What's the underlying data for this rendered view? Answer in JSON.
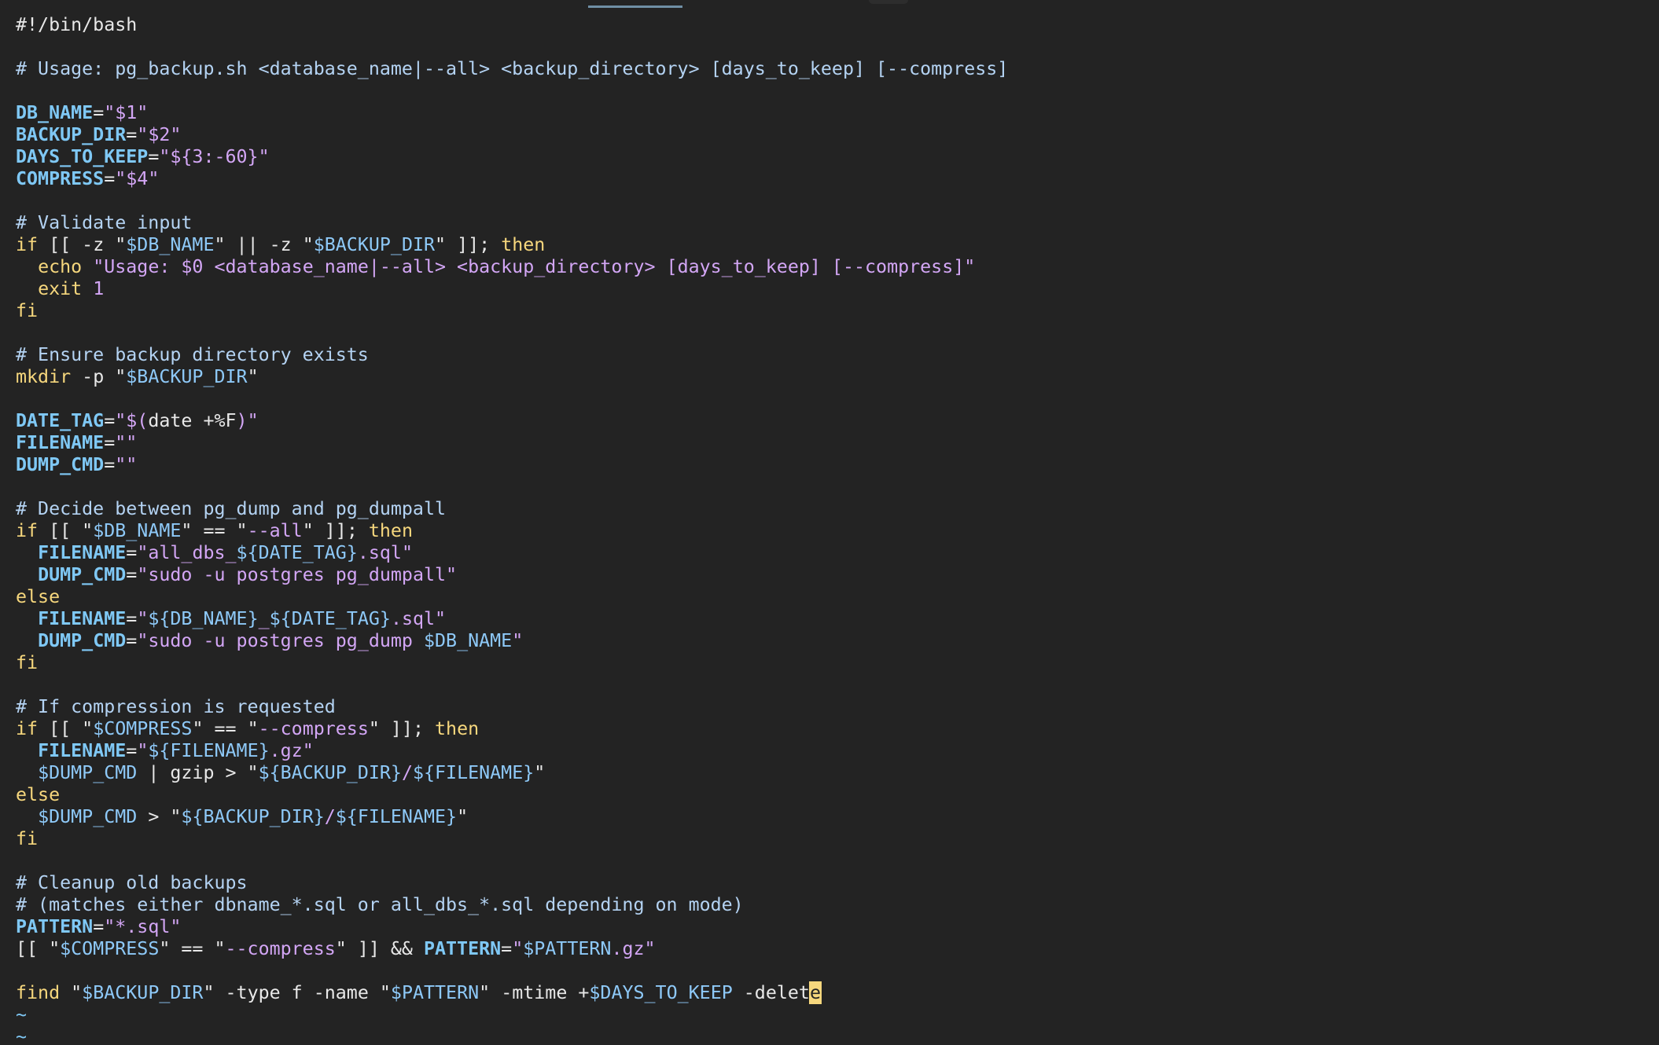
{
  "editor": {
    "lines": [
      [
        {
          "t": "#!/bin/bash",
          "k": "shebang"
        }
      ],
      [],
      [
        {
          "t": "# Usage: pg_backup.sh <database_name|--all> <backup_directory> [days_to_keep] [--compress]",
          "k": "comment"
        }
      ],
      [],
      [
        {
          "t": "DB_NAME",
          "k": "var"
        },
        {
          "t": "=",
          "k": "op"
        },
        {
          "t": "\"$1\"",
          "k": "str"
        }
      ],
      [
        {
          "t": "BACKUP_DIR",
          "k": "var"
        },
        {
          "t": "=",
          "k": "op"
        },
        {
          "t": "\"$2\"",
          "k": "str"
        }
      ],
      [
        {
          "t": "DAYS_TO_KEEP",
          "k": "var"
        },
        {
          "t": "=",
          "k": "op"
        },
        {
          "t": "\"${3:-60}\"",
          "k": "str"
        }
      ],
      [
        {
          "t": "COMPRESS",
          "k": "var"
        },
        {
          "t": "=",
          "k": "op"
        },
        {
          "t": "\"$4\"",
          "k": "str"
        }
      ],
      [],
      [
        {
          "t": "# Validate input",
          "k": "comment"
        }
      ],
      [
        {
          "t": "if",
          "k": "kw"
        },
        {
          "t": " [[ -z \"",
          "k": "plain"
        },
        {
          "t": "$DB_NAME",
          "k": "ref"
        },
        {
          "t": "\" || -z \"",
          "k": "plain"
        },
        {
          "t": "$BACKUP_DIR",
          "k": "ref"
        },
        {
          "t": "\" ]]; ",
          "k": "plain"
        },
        {
          "t": "then",
          "k": "kw"
        }
      ],
      [
        {
          "t": "  ",
          "k": "plain"
        },
        {
          "t": "echo",
          "k": "cmd"
        },
        {
          "t": " \"Usage: $0 <database_name|--all> <backup_directory> [days_to_keep] [--compress]\"",
          "k": "str"
        }
      ],
      [
        {
          "t": "  ",
          "k": "plain"
        },
        {
          "t": "exit",
          "k": "cmd"
        },
        {
          "t": " 1",
          "k": "str"
        }
      ],
      [
        {
          "t": "fi",
          "k": "kw"
        }
      ],
      [],
      [
        {
          "t": "# Ensure backup directory exists",
          "k": "comment"
        }
      ],
      [
        {
          "t": "mkdir",
          "k": "cmd"
        },
        {
          "t": " -p \"",
          "k": "plain"
        },
        {
          "t": "$BACKUP_DIR",
          "k": "ref"
        },
        {
          "t": "\"",
          "k": "plain"
        }
      ],
      [],
      [
        {
          "t": "DATE_TAG",
          "k": "var"
        },
        {
          "t": "=",
          "k": "op"
        },
        {
          "t": "\"$(",
          "k": "str"
        },
        {
          "t": "date +%F",
          "k": "plain"
        },
        {
          "t": ")\"",
          "k": "str"
        }
      ],
      [
        {
          "t": "FILENAME",
          "k": "var"
        },
        {
          "t": "=",
          "k": "op"
        },
        {
          "t": "\"\"",
          "k": "str"
        }
      ],
      [
        {
          "t": "DUMP_CMD",
          "k": "var"
        },
        {
          "t": "=",
          "k": "op"
        },
        {
          "t": "\"\"",
          "k": "str"
        }
      ],
      [],
      [
        {
          "t": "# Decide between pg_dump and pg_dumpall",
          "k": "comment"
        }
      ],
      [
        {
          "t": "if",
          "k": "kw"
        },
        {
          "t": " [[ \"",
          "k": "plain"
        },
        {
          "t": "$DB_NAME",
          "k": "ref"
        },
        {
          "t": "\" == \"",
          "k": "plain"
        },
        {
          "t": "--all",
          "k": "str"
        },
        {
          "t": "\" ]]; ",
          "k": "plain"
        },
        {
          "t": "then",
          "k": "kw"
        }
      ],
      [
        {
          "t": "  ",
          "k": "plain"
        },
        {
          "t": "FILENAME",
          "k": "var"
        },
        {
          "t": "=",
          "k": "op"
        },
        {
          "t": "\"all_dbs_",
          "k": "str"
        },
        {
          "t": "${DATE_TAG}",
          "k": "ref"
        },
        {
          "t": ".sql\"",
          "k": "str"
        }
      ],
      [
        {
          "t": "  ",
          "k": "plain"
        },
        {
          "t": "DUMP_CMD",
          "k": "var"
        },
        {
          "t": "=",
          "k": "op"
        },
        {
          "t": "\"sudo -u postgres pg_dumpall\"",
          "k": "str"
        }
      ],
      [
        {
          "t": "else",
          "k": "kw"
        }
      ],
      [
        {
          "t": "  ",
          "k": "plain"
        },
        {
          "t": "FILENAME",
          "k": "var"
        },
        {
          "t": "=",
          "k": "op"
        },
        {
          "t": "\"",
          "k": "str"
        },
        {
          "t": "${DB_NAME}",
          "k": "ref"
        },
        {
          "t": "_",
          "k": "str"
        },
        {
          "t": "${DATE_TAG}",
          "k": "ref"
        },
        {
          "t": ".sql\"",
          "k": "str"
        }
      ],
      [
        {
          "t": "  ",
          "k": "plain"
        },
        {
          "t": "DUMP_CMD",
          "k": "var"
        },
        {
          "t": "=",
          "k": "op"
        },
        {
          "t": "\"sudo -u postgres pg_dump ",
          "k": "str"
        },
        {
          "t": "$DB_NAME",
          "k": "ref"
        },
        {
          "t": "\"",
          "k": "str"
        }
      ],
      [
        {
          "t": "fi",
          "k": "kw"
        }
      ],
      [],
      [
        {
          "t": "# If compression is requested",
          "k": "comment"
        }
      ],
      [
        {
          "t": "if",
          "k": "kw"
        },
        {
          "t": " [[ \"",
          "k": "plain"
        },
        {
          "t": "$COMPRESS",
          "k": "ref"
        },
        {
          "t": "\" == \"",
          "k": "plain"
        },
        {
          "t": "--compress",
          "k": "str"
        },
        {
          "t": "\" ]]; ",
          "k": "plain"
        },
        {
          "t": "then",
          "k": "kw"
        }
      ],
      [
        {
          "t": "  ",
          "k": "plain"
        },
        {
          "t": "FILENAME",
          "k": "var"
        },
        {
          "t": "=",
          "k": "op"
        },
        {
          "t": "\"",
          "k": "str"
        },
        {
          "t": "${FILENAME}",
          "k": "ref"
        },
        {
          "t": ".gz\"",
          "k": "str"
        }
      ],
      [
        {
          "t": "  ",
          "k": "plain"
        },
        {
          "t": "$DUMP_CMD",
          "k": "ref"
        },
        {
          "t": " | gzip > \"",
          "k": "plain"
        },
        {
          "t": "${BACKUP_DIR}",
          "k": "ref"
        },
        {
          "t": "/",
          "k": "str"
        },
        {
          "t": "${FILENAME}",
          "k": "ref"
        },
        {
          "t": "\"",
          "k": "plain"
        }
      ],
      [
        {
          "t": "else",
          "k": "kw"
        }
      ],
      [
        {
          "t": "  ",
          "k": "plain"
        },
        {
          "t": "$DUMP_CMD",
          "k": "ref"
        },
        {
          "t": " > \"",
          "k": "plain"
        },
        {
          "t": "${BACKUP_DIR}",
          "k": "ref"
        },
        {
          "t": "/",
          "k": "str"
        },
        {
          "t": "${FILENAME}",
          "k": "ref"
        },
        {
          "t": "\"",
          "k": "plain"
        }
      ],
      [
        {
          "t": "fi",
          "k": "kw"
        }
      ],
      [],
      [
        {
          "t": "# Cleanup old backups",
          "k": "comment"
        }
      ],
      [
        {
          "t": "# (matches either dbname_*.sql or all_dbs_*.sql depending on mode)",
          "k": "comment"
        }
      ],
      [
        {
          "t": "PATTERN",
          "k": "var"
        },
        {
          "t": "=",
          "k": "op"
        },
        {
          "t": "\"*.sql\"",
          "k": "str"
        }
      ],
      [
        {
          "t": "[[ \"",
          "k": "plain"
        },
        {
          "t": "$COMPRESS",
          "k": "ref"
        },
        {
          "t": "\" == \"",
          "k": "plain"
        },
        {
          "t": "--compress",
          "k": "str"
        },
        {
          "t": "\" ]] && ",
          "k": "plain"
        },
        {
          "t": "PATTERN",
          "k": "var"
        },
        {
          "t": "=",
          "k": "op"
        },
        {
          "t": "\"",
          "k": "str"
        },
        {
          "t": "$PATTERN",
          "k": "ref"
        },
        {
          "t": ".gz\"",
          "k": "str"
        }
      ],
      [],
      [
        {
          "t": "find",
          "k": "cmd"
        },
        {
          "t": " \"",
          "k": "plain"
        },
        {
          "t": "$BACKUP_DIR",
          "k": "ref"
        },
        {
          "t": "\" -type f -name \"",
          "k": "plain"
        },
        {
          "t": "$PATTERN",
          "k": "ref"
        },
        {
          "t": "\" -mtime +",
          "k": "plain"
        },
        {
          "t": "$DAYS_TO_KEEP",
          "k": "ref"
        },
        {
          "t": " -delet",
          "k": "plain"
        },
        {
          "t": "e",
          "k": "cursor"
        }
      ],
      [
        {
          "t": "~",
          "k": "tilde"
        }
      ],
      [
        {
          "t": "~",
          "k": "tilde"
        }
      ]
    ]
  }
}
